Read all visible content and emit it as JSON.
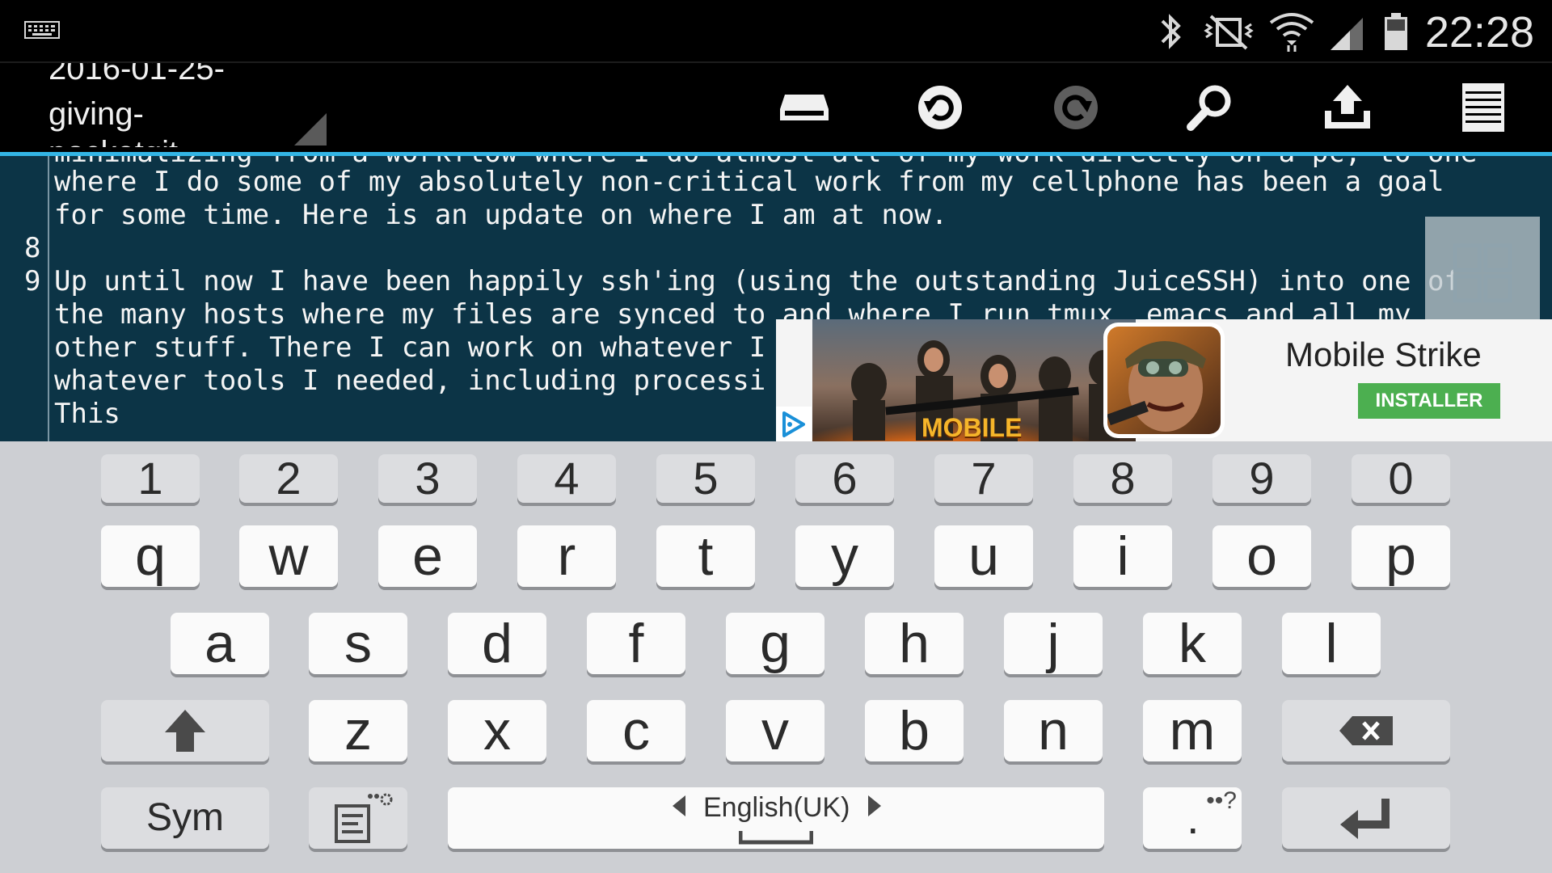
{
  "status_bar": {
    "time": "22:28",
    "icons": [
      "keyboard-icon",
      "bluetooth-icon",
      "vibrate-silent-icon",
      "wifi-icon",
      "signal-icon",
      "battery-icon"
    ]
  },
  "toolbar": {
    "file_title_line1": "2016-01-25-",
    "file_title_line2": "giving-",
    "file_title_line3": "pocketgit",
    "buttons": [
      "save-icon",
      "undo-icon",
      "redo-icon",
      "search-icon",
      "upload-icon",
      "menu-icon"
    ]
  },
  "editor": {
    "cut_line": "minimalizing from a workflow where I do almost all of my work directly on a pc, to one",
    "lines": [
      {
        "num": "",
        "text": "where I do some of my absolutely non-critical work from my cellphone has been a goal"
      },
      {
        "num": "",
        "text": "for some time. Here is an update on where I am at now."
      },
      {
        "num": "8",
        "text": ""
      },
      {
        "num": "9",
        "text": "Up until now I have been happily ssh'ing (using the outstanding JuiceSSH) into one of"
      },
      {
        "num": "",
        "text": "the many hosts where my files are synced to and where I run tmux, emacs and all my"
      },
      {
        "num": "",
        "text": "other stuff. There I can work on whatever I"
      },
      {
        "num": "",
        "text": "whatever tools I needed, including processi"
      },
      {
        "num": "",
        "text": "This"
      }
    ]
  },
  "ad": {
    "title": "Mobile Strike",
    "button": "INSTALLER",
    "image_text": "MOBILE",
    "colors": {
      "button": "#4caf50"
    }
  },
  "keyboard": {
    "number_row": [
      "1",
      "2",
      "3",
      "4",
      "5",
      "6",
      "7",
      "8",
      "9",
      "0"
    ],
    "row1": [
      "q",
      "w",
      "e",
      "r",
      "t",
      "y",
      "u",
      "i",
      "o",
      "p"
    ],
    "row2": [
      "a",
      "s",
      "d",
      "f",
      "g",
      "h",
      "j",
      "k",
      "l"
    ],
    "row3": [
      "z",
      "x",
      "c",
      "v",
      "b",
      "n",
      "m"
    ],
    "sym_label": "Sym",
    "language": "English(UK)",
    "period": ".",
    "period_extra": "••?"
  },
  "colors": {
    "editor_bg": "#0c3446",
    "accent": "#33b5e5",
    "keyboard_bg": "#cdcfd3"
  }
}
